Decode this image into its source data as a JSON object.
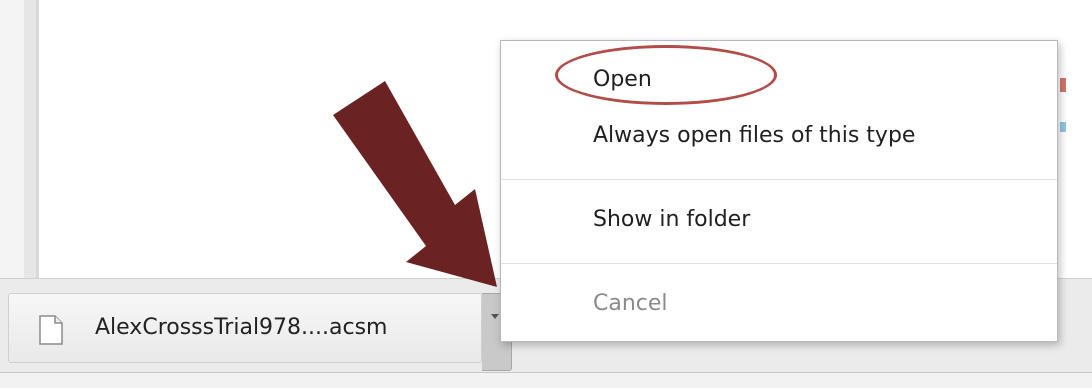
{
  "download": {
    "file_name": "AlexCrosssTrial978....acsm",
    "file_icon": "document-icon"
  },
  "context_menu": {
    "items": [
      {
        "label": "Open",
        "enabled": true,
        "highlighted": true
      },
      {
        "label": "Always open files of this type",
        "enabled": true
      },
      {
        "label": "Show in folder",
        "enabled": true
      },
      {
        "label": "Cancel",
        "enabled": false
      }
    ]
  },
  "annotations": {
    "highlight_color": "#b24c48",
    "arrow_color": "#6b2222"
  }
}
